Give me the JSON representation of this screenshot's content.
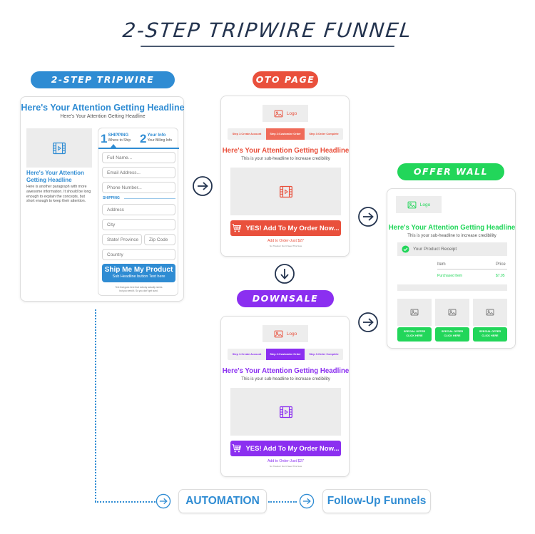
{
  "title": "2-STEP TRIPWIRE FUNNEL",
  "colors": {
    "blue": "#2f8cd3",
    "red": "#e9503c",
    "green": "#22d65a",
    "purple": "#8b2ff0",
    "navy": "#24344f"
  },
  "optin": {
    "label": "2-STEP TRIPWIRE FUNNEL",
    "headline": "Here's Your Attention Getting Headline",
    "subheadline": "Here's Your Attention Getting Headline",
    "video_icon": "video-icon",
    "left_headline": "Here's Your Attention Getting Headline",
    "paragraph": "Here is another paragraph with more awesome information. It should be long enough to explain the concepts, but short enough to keep their attention.",
    "steps": [
      {
        "num": "1",
        "title": "SHIPPING",
        "sub": "Where to Ship"
      },
      {
        "num": "2",
        "title": "Your Info",
        "sub": "Your Billing Info"
      }
    ],
    "fields": {
      "full_name": "Full Name...",
      "email": "Email Address...",
      "phone": "Phone Number...",
      "shipping_label": "SHIPPING",
      "address": "Address",
      "city": "City",
      "state": "State/ Province",
      "zip": "Zip Code",
      "country": "Country"
    },
    "button_main": "Ship Me My Product",
    "button_sub": "Sub Headline button Text here",
    "fine_print_1": "Text that goes here that nobody actually needs",
    "fine_print_2": "but you need it. So you don't get sued."
  },
  "oto": {
    "label": "OTO PAGE",
    "logo": "Logo",
    "steps": [
      "Step 1:Create Account",
      "Step 2:Customize Order",
      "Step 3:Order Complete"
    ],
    "active_step": 1,
    "headline": "Here's Your Attention Getting Headline",
    "subheadline": "This is your sub-headline to increase credibility",
    "button": "YES! Add To My Order Now...",
    "add_order": "Add to Order-Just $27",
    "no_thanks": "No Thanks I Don't Need This Now"
  },
  "downsale": {
    "label": "DOWNSALE PAGE",
    "logo": "Logo",
    "steps": [
      "Step 1:Create Account",
      "Step 2:Customize Order",
      "Step 3:Order Complete"
    ],
    "active_step": 1,
    "headline": "Here's Your Attention Getting Headline",
    "subheadline": "This is your sub-headline to increase credibility",
    "button": "YES! Add To My Order Now...",
    "add_order": "Add to Order-Just $27",
    "no_thanks": "No Thanks I Don't Need This Now"
  },
  "offer_wall": {
    "label": "OFFER WALL PAGE",
    "logo": "Logo",
    "headline": "Here's Your Attention Getting Headline",
    "subheadline": "This is your sub-headline to increase credibility",
    "receipt": "Your Product Receipt",
    "col_item": "Item",
    "col_price": "Price",
    "row_item": "Purchased Item",
    "row_price": "$7.95",
    "offers": [
      {
        "line1": "SPECIAL OFFER",
        "line2": "CLICK HERE"
      },
      {
        "line1": "SPECIAL OFFER",
        "line2": "CLICK HERE"
      },
      {
        "line1": "SPECIAL OFFER",
        "line2": "CLICK HERE"
      }
    ]
  },
  "bottom": {
    "automation": "AUTOMATION",
    "followup": "Follow-Up Funnels"
  }
}
